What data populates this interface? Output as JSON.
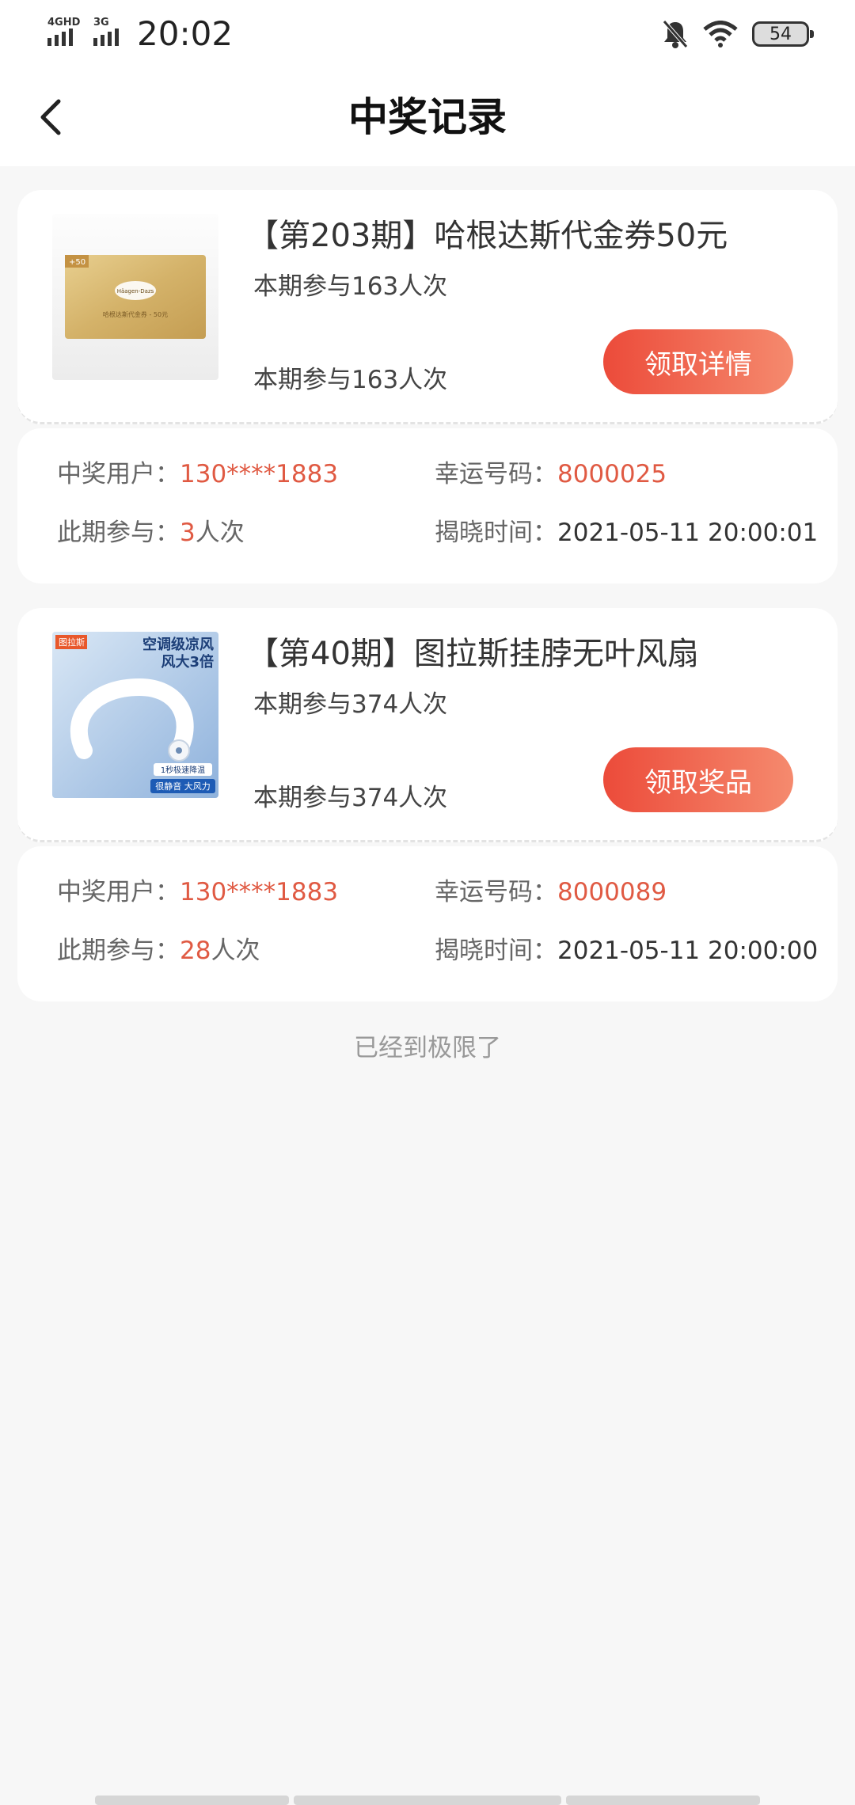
{
  "status_bar": {
    "network_1": "4GHD",
    "network_2": "3G",
    "time": "20:02",
    "battery": "54",
    "icons": [
      "bell-muted-icon",
      "wifi-icon",
      "battery-icon"
    ]
  },
  "header": {
    "title": "中奖记录",
    "back_icon": "chevron-left-icon"
  },
  "records": [
    {
      "image": "haagen-dazs-voucher",
      "image_text": {
        "badge": "+50",
        "brand": "Häagen-Dazs",
        "caption": "哈根达斯代金券 - 50元"
      },
      "title": "【第203期】哈根达斯代金券50元",
      "participants_line_1": "本期参与163人次",
      "participants_line_2": "本期参与163人次",
      "button": "领取详情",
      "winner_label": "中奖用户：",
      "winner_value": "130****1883",
      "lucky_label": "幸运号码：",
      "lucky_value": "8000025",
      "joined_label": "此期参与：",
      "joined_count": "3",
      "joined_unit": "人次",
      "reveal_label": "揭晓时间：",
      "reveal_value": "2021-05-11 20:00:01"
    },
    {
      "image": "neck-fan-product",
      "image_text": {
        "badge": "图拉斯",
        "headline_1": "空调级凉风",
        "headline_2": "风大3倍",
        "tag_1": "1秒极速降温",
        "tag_2": "很静音 大风力"
      },
      "title": "【第40期】图拉斯挂脖无叶风扇",
      "participants_line_1": "本期参与374人次",
      "participants_line_2": "本期参与374人次",
      "button": "领取奖品",
      "winner_label": "中奖用户：",
      "winner_value": "130****1883",
      "lucky_label": "幸运号码：",
      "lucky_value": "8000089",
      "joined_label": "此期参与：",
      "joined_count": "28",
      "joined_unit": "人次",
      "reveal_label": "揭晓时间：",
      "reveal_value": "2021-05-11 20:00:00"
    }
  ],
  "footer": {
    "end_text": "已经到极限了"
  },
  "colors": {
    "accent_start": "#ec4b3a",
    "accent_end": "#f58a6e",
    "highlight_text": "#e05a43",
    "background": "#f7f7f7"
  }
}
